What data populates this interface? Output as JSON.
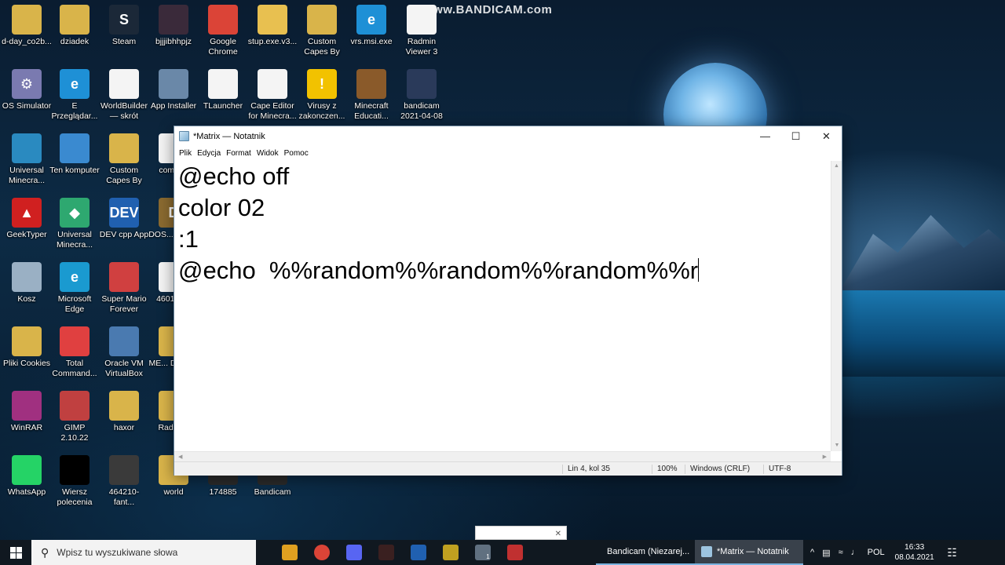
{
  "watermark": "www.BANDICAM.com",
  "desktop": {
    "icons": [
      {
        "label": "d-day_co2b...",
        "glyph": "",
        "color": "#d9b44a"
      },
      {
        "label": "dziadek",
        "glyph": "",
        "color": "#d9b44a"
      },
      {
        "label": "Steam",
        "glyph": "S",
        "color": "#1b2838"
      },
      {
        "label": "bjjjibhhpjz",
        "glyph": "",
        "color": "#3a2a3a"
      },
      {
        "label": "Google Chrome",
        "glyph": "",
        "color": "#db4437"
      },
      {
        "label": "stup.exe.v3...",
        "glyph": "",
        "color": "#e8c050"
      },
      {
        "label": "Custom Capes By Bi...",
        "glyph": "",
        "color": "#d9b44a"
      },
      {
        "label": "vrs.msi.exe",
        "glyph": "e",
        "color": "#1e90d6"
      },
      {
        "label": "Radmin Viewer 3",
        "glyph": "",
        "color": "#f4f4f4"
      },
      {
        "label": "OS Simulator",
        "glyph": "⚙",
        "color": "#7a7ab0"
      },
      {
        "label": "E Przeglądar...",
        "glyph": "e",
        "color": "#1e90d6"
      },
      {
        "label": "WorldBuilder — skrót",
        "glyph": "",
        "color": "#f4f4f4"
      },
      {
        "label": "App Installer",
        "glyph": "",
        "color": "#6a88a8"
      },
      {
        "label": "TLauncher",
        "glyph": "",
        "color": "#f4f4f4"
      },
      {
        "label": "Cape Editor for Minecra...",
        "glyph": "",
        "color": "#f4f4f4"
      },
      {
        "label": "Virusy z zakonczen...",
        "glyph": "!",
        "color": "#f2c200"
      },
      {
        "label": "Minecraft Educati...",
        "glyph": "",
        "color": "#8a5a2a"
      },
      {
        "label": "bandicam 2021-04-08 ...",
        "glyph": "",
        "color": "#2a3a5a"
      },
      {
        "label": "Universal Minecra...",
        "glyph": "",
        "color": "#2a8ac0"
      },
      {
        "label": "Ten komputer",
        "glyph": "",
        "color": "#3a8ad0"
      },
      {
        "label": "Custom Capes By Bi...",
        "glyph": "",
        "color": "#d9b44a"
      },
      {
        "label": "com.p...",
        "glyph": "",
        "color": "#f4f4f4"
      },
      {
        "label": "GeekTyper",
        "glyph": "▲",
        "color": "#d02020"
      },
      {
        "label": "Universal Minecra...",
        "glyph": "◆",
        "color": "#2ea870"
      },
      {
        "label": "DEV cpp App",
        "glyph": "DEV",
        "color": "#2060b0"
      },
      {
        "label": "DOS... 0.74...",
        "glyph": "D",
        "color": "#8a6a30"
      },
      {
        "label": "Kosz",
        "glyph": "",
        "color": "#9ab0c4"
      },
      {
        "label": "Microsoft Edge",
        "glyph": "e",
        "color": "#1a9ad0"
      },
      {
        "label": "Super Mario Forever v7.02",
        "glyph": "",
        "color": "#d04040"
      },
      {
        "label": "460105...",
        "glyph": "",
        "color": "#f4f4f4"
      },
      {
        "label": "Pliki Cookies",
        "glyph": "",
        "color": "#d9b44a"
      },
      {
        "label": "Total Command...",
        "glyph": "",
        "color": "#e04040"
      },
      {
        "label": "Oracle VM VirtualBox",
        "glyph": "",
        "color": "#4a7ab0"
      },
      {
        "label": "ME... Down...",
        "glyph": "",
        "color": "#d9b44a"
      },
      {
        "label": "WinRAR",
        "glyph": "",
        "color": "#a03080"
      },
      {
        "label": "GIMP 2.10.22",
        "glyph": "",
        "color": "#c04040"
      },
      {
        "label": "haxor",
        "glyph": "",
        "color": "#d9b44a"
      },
      {
        "label": "Radmi...",
        "glyph": "",
        "color": "#d9b44a"
      },
      {
        "label": "WhatsApp",
        "glyph": "",
        "color": "#25d366"
      },
      {
        "label": "Wiersz polecenia",
        "glyph": "",
        "color": "#000000"
      },
      {
        "label": "464210-fant...",
        "glyph": "",
        "color": "#3a3a3a"
      },
      {
        "label": "world",
        "glyph": "",
        "color": "#d9b44a"
      },
      {
        "label": "174885",
        "glyph": "",
        "color": "#2a2a2a"
      },
      {
        "label": "Bandicam",
        "glyph": "",
        "color": "#2a2a2a"
      }
    ]
  },
  "notepad": {
    "title": "*Matrix — Notatnik",
    "menu": [
      "Plik",
      "Edycja",
      "Format",
      "Widok",
      "Pomoc"
    ],
    "lines": [
      "@echo off",
      "color 02",
      ":1",
      "@echo  %%random%%random%%random%%r"
    ],
    "status": {
      "position": "Lin 4, kol 35",
      "zoom": "100%",
      "line_ending": "Windows (CRLF)",
      "encoding": "UTF-8"
    }
  },
  "taskbar": {
    "search_placeholder": "Wpisz tu wyszukiwane słowa",
    "tasks": [
      {
        "label": "Bandicam (Niezarej...",
        "color": "#e02020"
      },
      {
        "label": "*Matrix — Notatnik",
        "color": "#9cc4e0"
      }
    ],
    "badge": "1",
    "tray_chevron": "^",
    "language": "POL",
    "time": "16:33",
    "date": "08.04.2021"
  }
}
